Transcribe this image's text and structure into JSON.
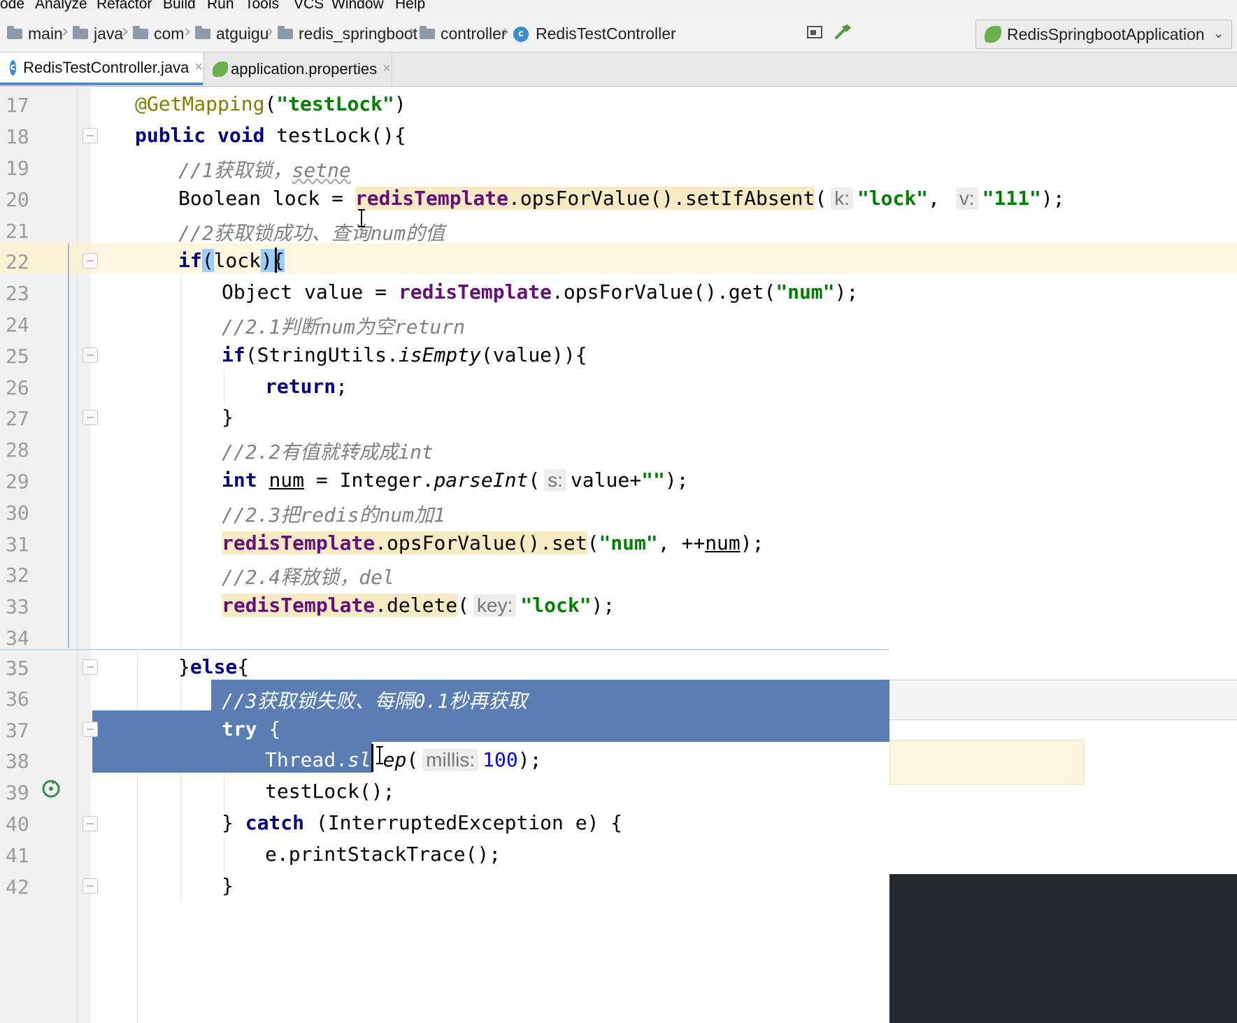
{
  "menu": [
    "ode",
    "Analyze",
    "Refactor",
    "Build",
    "Run",
    "Tools",
    "VCS",
    "Window",
    "Help"
  ],
  "breadcrumbs": [
    "main",
    "java",
    "com",
    "atguigu",
    "redis_springboot",
    "controller",
    "RedisTestController"
  ],
  "run_config": "RedisSpringbootApplication",
  "tabs": [
    {
      "label": "RedisTestController.java",
      "active": true
    },
    {
      "label": "application.properties",
      "active": false
    }
  ],
  "tab_close": "×",
  "lines": [
    {
      "n": "17"
    },
    {
      "n": "18"
    },
    {
      "n": "19"
    },
    {
      "n": "20"
    },
    {
      "n": "21"
    },
    {
      "n": "22"
    },
    {
      "n": "23"
    },
    {
      "n": "24"
    },
    {
      "n": "25"
    },
    {
      "n": "26"
    },
    {
      "n": "27"
    },
    {
      "n": "28"
    },
    {
      "n": "29"
    },
    {
      "n": "30"
    },
    {
      "n": "31"
    },
    {
      "n": "32"
    },
    {
      "n": "33"
    },
    {
      "n": "34"
    },
    {
      "n": "35"
    },
    {
      "n": "36"
    },
    {
      "n": "37"
    },
    {
      "n": "38"
    },
    {
      "n": "39"
    },
    {
      "n": "40"
    },
    {
      "n": "41"
    },
    {
      "n": "42"
    }
  ],
  "code": {
    "l17": {
      "annotation": "@GetMapping",
      "open": "(",
      "str": "\"testLock\"",
      "close": ")"
    },
    "l18": {
      "kw": "public void",
      "rest": " testLock(){"
    },
    "l19": {
      "comment": "//1获取锁，",
      "wavy": "setne"
    },
    "l20": {
      "a": "Boolean lock = ",
      "field": "redisTemplate",
      "b": ".opsForValue().setIfAbsent",
      "c": "(",
      "hint_k": "k:",
      "s1": "\"lock\"",
      "comma": ",",
      "hint_v": "v:",
      "s2": "\"111\"",
      "end": ");"
    },
    "l21": {
      "comment": "//2获取锁成功、查询num的值"
    },
    "l22": {
      "kw": "if",
      "p1": "(",
      "var": "lock",
      "p2": ")",
      "brace": "{"
    },
    "l23": {
      "a": "Object value = ",
      "field": "redisTemplate",
      "b": ".opsForValue().get(",
      "str": "\"num\"",
      "end": ");"
    },
    "l24": {
      "comment": "//2.1判断num为空return"
    },
    "l25": {
      "kw": "if",
      "a": "(StringUtils.",
      "it": "isEmpty",
      "b": "(value)){"
    },
    "l26": {
      "kw": "return",
      "end": ";"
    },
    "l27": {
      "text": "}"
    },
    "l28": {
      "comment": "//2.2有值就转成成int"
    },
    "l29": {
      "kw": "int",
      "var": "num",
      "a": " = Integer.",
      "it": "parseInt",
      "b": "(",
      "hint": "s:",
      "c": "value+",
      "str": "\"\"",
      "end": ");"
    },
    "l30": {
      "comment": "//2.3把redis的num加1"
    },
    "l31": {
      "field": "redisTemplate",
      "a": ".opsForValue().set",
      "b": "(",
      "str": "\"num\"",
      "c": ", ++",
      "var": "num",
      "end": ");"
    },
    "l32": {
      "comment": "//2.4释放锁，del"
    },
    "l33": {
      "field": "redisTemplate",
      "a": ".delete",
      "b": "(",
      "hint": "key:",
      "str": "\"lock\"",
      "end": ");"
    },
    "l35": {
      "a": "}",
      "kw": "else",
      "b": "{"
    },
    "l36": {
      "comment": "//3获取锁失败、每隔0.1秒再获取"
    },
    "l37": {
      "kw": "try",
      "b": " {"
    },
    "l38": {
      "a": "Thread.",
      "it1": "sle",
      "it2": "ep",
      "b": "(",
      "hint": "millis:",
      "num": "100",
      "end": ");"
    },
    "l39": {
      "a": "testLock();"
    },
    "l40": {
      "a": "} ",
      "kw": "catch",
      "b": " (InterruptedException e) {"
    },
    "l41": {
      "a": "e.printStackTrace();"
    },
    "l42": {
      "a": "}"
    }
  }
}
